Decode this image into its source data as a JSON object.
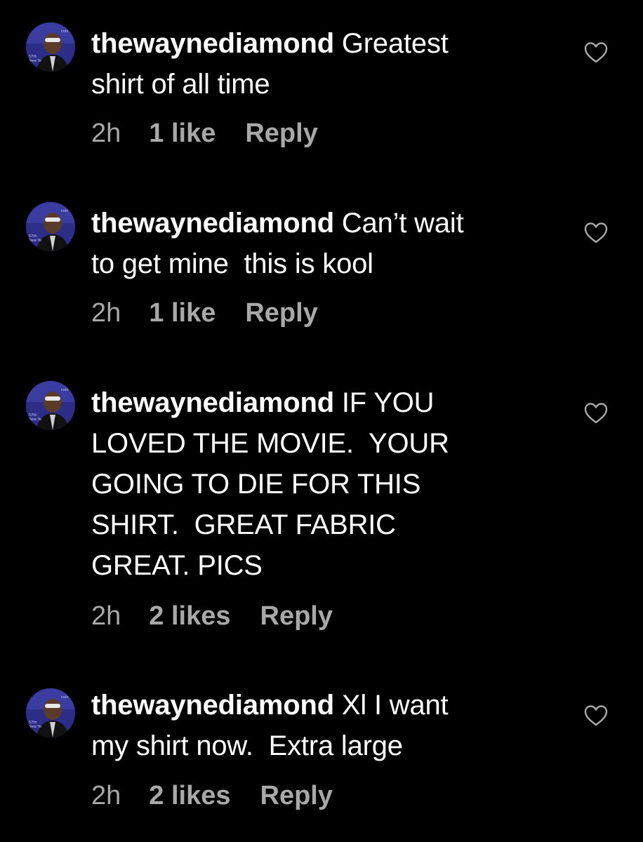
{
  "comments": [
    {
      "username": "thewaynediamond",
      "text": "Greatest\nshirt of all time",
      "time": "2h",
      "likes": "1 like",
      "reply": "Reply"
    },
    {
      "username": "thewaynediamond",
      "text": "Can’t wait\nto get mine  this is kool",
      "time": "2h",
      "likes": "1 like",
      "reply": "Reply"
    },
    {
      "username": "thewaynediamond",
      "text": "IF YOU\nLOVED THE MOVIE.  YOUR\nGOING TO DIE FOR THIS\nSHIRT.  GREAT FABRIC\nGREAT. PICS",
      "time": "2h",
      "likes": "2 likes",
      "reply": "Reply"
    },
    {
      "username": "thewaynediamond",
      "text": "Xl I want\nmy shirt now.  Extra large",
      "time": "2h",
      "likes": "2 likes",
      "reply": "Reply"
    }
  ],
  "icons": {
    "like": "heart-outline-icon",
    "avatar": "profile-photo"
  },
  "colors": {
    "background": "#000000",
    "text": "#ffffff",
    "meta": "#a8a8a8"
  }
}
